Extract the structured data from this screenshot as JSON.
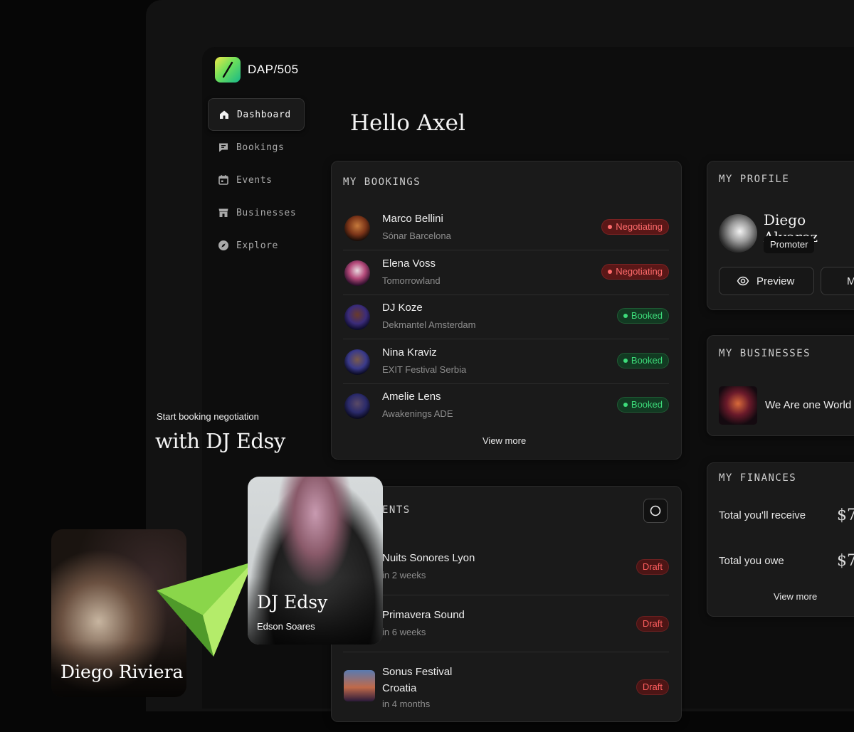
{
  "brand": {
    "name": "DAP/505"
  },
  "nav": [
    {
      "label": "Dashboard",
      "icon": "home-icon",
      "active": true
    },
    {
      "label": "Bookings",
      "icon": "message-icon",
      "active": false
    },
    {
      "label": "Events",
      "icon": "calendar-icon",
      "active": false
    },
    {
      "label": "Businesses",
      "icon": "store-icon",
      "active": false
    },
    {
      "label": "Explore",
      "icon": "compass-icon",
      "active": false
    }
  ],
  "greeting": "Hello Axel",
  "bookings": {
    "title": "MY BOOKINGS",
    "items": [
      {
        "name": "Marco Bellini",
        "venue": "Sónar Barcelona",
        "status": "Negotiating"
      },
      {
        "name": "Elena Voss",
        "venue": "Tomorrowland",
        "status": "Negotiating"
      },
      {
        "name": "DJ Koze",
        "venue": "Dekmantel Amsterdam",
        "status": "Booked"
      },
      {
        "name": "Nina Kraviz",
        "venue": "EXIT Festival Serbia",
        "status": "Booked"
      },
      {
        "name": "Amelie Lens",
        "venue": "Awakenings ADE",
        "status": "Booked"
      }
    ],
    "view_more": "View more"
  },
  "events": {
    "title_partial": "ENTS",
    "items": [
      {
        "name": "Nuits Sonores Lyon",
        "when": "in 2 weeks",
        "status": "Draft"
      },
      {
        "name": "Primavera Sound",
        "when": "in 6 weeks",
        "status": "Draft"
      },
      {
        "name": "Sonus Festival Croatia",
        "name_line1": "Sonus Festival",
        "name_line2": "Croatia",
        "when": "in 4 months",
        "status": "Draft"
      }
    ]
  },
  "profile": {
    "title": "MY PROFILE",
    "name": "Diego Alvarez",
    "role": "Promoter",
    "preview_label": "Preview",
    "second_button_partial": "M"
  },
  "businesses": {
    "title": "MY BUSINESSES",
    "item_name": "We Are one World"
  },
  "finances": {
    "title": "MY FINANCES",
    "receive_label": "Total you'll receive",
    "receive_value": "$7",
    "owe_label": "Total you owe",
    "owe_value": "$7",
    "view_more": "View more"
  },
  "overlay": {
    "caption_small": "Start booking negotiation",
    "caption_large": "with DJ Edsy",
    "dj_card": {
      "name": "DJ Edsy",
      "real_name": "Edson Soares"
    },
    "promoter_card": {
      "name": "Diego Riviera"
    }
  },
  "colors": {
    "negotiating": "#ff6b6b",
    "booked": "#3ddc7a",
    "draft": "#ff5f5f",
    "accent_green": "#6fe05a"
  }
}
